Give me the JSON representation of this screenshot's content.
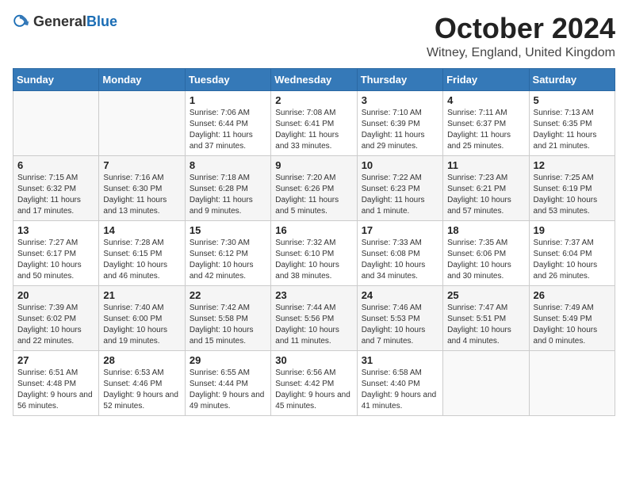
{
  "header": {
    "logo_general": "General",
    "logo_blue": "Blue",
    "month_title": "October 2024",
    "location": "Witney, England, United Kingdom"
  },
  "days_of_week": [
    "Sunday",
    "Monday",
    "Tuesday",
    "Wednesday",
    "Thursday",
    "Friday",
    "Saturday"
  ],
  "weeks": [
    [
      {
        "day": "",
        "info": ""
      },
      {
        "day": "",
        "info": ""
      },
      {
        "day": "1",
        "info": "Sunrise: 7:06 AM\nSunset: 6:44 PM\nDaylight: 11 hours and 37 minutes."
      },
      {
        "day": "2",
        "info": "Sunrise: 7:08 AM\nSunset: 6:41 PM\nDaylight: 11 hours and 33 minutes."
      },
      {
        "day": "3",
        "info": "Sunrise: 7:10 AM\nSunset: 6:39 PM\nDaylight: 11 hours and 29 minutes."
      },
      {
        "day": "4",
        "info": "Sunrise: 7:11 AM\nSunset: 6:37 PM\nDaylight: 11 hours and 25 minutes."
      },
      {
        "day": "5",
        "info": "Sunrise: 7:13 AM\nSunset: 6:35 PM\nDaylight: 11 hours and 21 minutes."
      }
    ],
    [
      {
        "day": "6",
        "info": "Sunrise: 7:15 AM\nSunset: 6:32 PM\nDaylight: 11 hours and 17 minutes."
      },
      {
        "day": "7",
        "info": "Sunrise: 7:16 AM\nSunset: 6:30 PM\nDaylight: 11 hours and 13 minutes."
      },
      {
        "day": "8",
        "info": "Sunrise: 7:18 AM\nSunset: 6:28 PM\nDaylight: 11 hours and 9 minutes."
      },
      {
        "day": "9",
        "info": "Sunrise: 7:20 AM\nSunset: 6:26 PM\nDaylight: 11 hours and 5 minutes."
      },
      {
        "day": "10",
        "info": "Sunrise: 7:22 AM\nSunset: 6:23 PM\nDaylight: 11 hours and 1 minute."
      },
      {
        "day": "11",
        "info": "Sunrise: 7:23 AM\nSunset: 6:21 PM\nDaylight: 10 hours and 57 minutes."
      },
      {
        "day": "12",
        "info": "Sunrise: 7:25 AM\nSunset: 6:19 PM\nDaylight: 10 hours and 53 minutes."
      }
    ],
    [
      {
        "day": "13",
        "info": "Sunrise: 7:27 AM\nSunset: 6:17 PM\nDaylight: 10 hours and 50 minutes."
      },
      {
        "day": "14",
        "info": "Sunrise: 7:28 AM\nSunset: 6:15 PM\nDaylight: 10 hours and 46 minutes."
      },
      {
        "day": "15",
        "info": "Sunrise: 7:30 AM\nSunset: 6:12 PM\nDaylight: 10 hours and 42 minutes."
      },
      {
        "day": "16",
        "info": "Sunrise: 7:32 AM\nSunset: 6:10 PM\nDaylight: 10 hours and 38 minutes."
      },
      {
        "day": "17",
        "info": "Sunrise: 7:33 AM\nSunset: 6:08 PM\nDaylight: 10 hours and 34 minutes."
      },
      {
        "day": "18",
        "info": "Sunrise: 7:35 AM\nSunset: 6:06 PM\nDaylight: 10 hours and 30 minutes."
      },
      {
        "day": "19",
        "info": "Sunrise: 7:37 AM\nSunset: 6:04 PM\nDaylight: 10 hours and 26 minutes."
      }
    ],
    [
      {
        "day": "20",
        "info": "Sunrise: 7:39 AM\nSunset: 6:02 PM\nDaylight: 10 hours and 22 minutes."
      },
      {
        "day": "21",
        "info": "Sunrise: 7:40 AM\nSunset: 6:00 PM\nDaylight: 10 hours and 19 minutes."
      },
      {
        "day": "22",
        "info": "Sunrise: 7:42 AM\nSunset: 5:58 PM\nDaylight: 10 hours and 15 minutes."
      },
      {
        "day": "23",
        "info": "Sunrise: 7:44 AM\nSunset: 5:56 PM\nDaylight: 10 hours and 11 minutes."
      },
      {
        "day": "24",
        "info": "Sunrise: 7:46 AM\nSunset: 5:53 PM\nDaylight: 10 hours and 7 minutes."
      },
      {
        "day": "25",
        "info": "Sunrise: 7:47 AM\nSunset: 5:51 PM\nDaylight: 10 hours and 4 minutes."
      },
      {
        "day": "26",
        "info": "Sunrise: 7:49 AM\nSunset: 5:49 PM\nDaylight: 10 hours and 0 minutes."
      }
    ],
    [
      {
        "day": "27",
        "info": "Sunrise: 6:51 AM\nSunset: 4:48 PM\nDaylight: 9 hours and 56 minutes."
      },
      {
        "day": "28",
        "info": "Sunrise: 6:53 AM\nSunset: 4:46 PM\nDaylight: 9 hours and 52 minutes."
      },
      {
        "day": "29",
        "info": "Sunrise: 6:55 AM\nSunset: 4:44 PM\nDaylight: 9 hours and 49 minutes."
      },
      {
        "day": "30",
        "info": "Sunrise: 6:56 AM\nSunset: 4:42 PM\nDaylight: 9 hours and 45 minutes."
      },
      {
        "day": "31",
        "info": "Sunrise: 6:58 AM\nSunset: 4:40 PM\nDaylight: 9 hours and 41 minutes."
      },
      {
        "day": "",
        "info": ""
      },
      {
        "day": "",
        "info": ""
      }
    ]
  ]
}
